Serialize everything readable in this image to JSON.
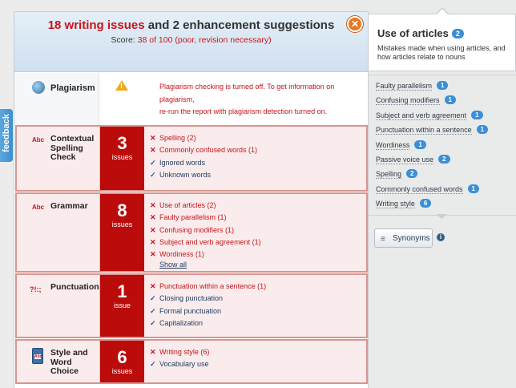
{
  "header": {
    "title_count": "18 writing issues",
    "title_rest": " and 2 enhancement suggestions",
    "score_prefix": "Score: ",
    "score_value": "38 of 100 (poor, revision necessary)",
    "close_glyph": "✕"
  },
  "plagiarism": {
    "name": "Plagiarism",
    "message_line1": "Plagiarism checking is turned off. To get information on",
    "message_line2": "plagiarism,",
    "message_line3": "re-run the report with plagiarism detection turned on."
  },
  "categories": [
    {
      "icon_text": "Abc",
      "name": "Contextual Spelling Check",
      "count": "3",
      "count_label": "issues",
      "items": [
        {
          "label": "Spelling (2)",
          "status": "bad"
        },
        {
          "label": "Commonly confused words (1)",
          "status": "bad"
        },
        {
          "label": "Ignored words",
          "status": "good"
        },
        {
          "label": "Unknown words",
          "status": "good"
        }
      ]
    },
    {
      "icon_text": "Abc",
      "name": "Grammar",
      "count": "8",
      "count_label": "issues",
      "items": [
        {
          "label": "Use of articles (2)",
          "status": "bad"
        },
        {
          "label": "Faulty parallelism (1)",
          "status": "bad"
        },
        {
          "label": "Confusing modifiers (1)",
          "status": "bad"
        },
        {
          "label": "Subject and verb agreement (1)",
          "status": "bad"
        },
        {
          "label": "Wordiness (1)",
          "status": "bad"
        }
      ],
      "show_all": "Show all"
    },
    {
      "icon_text": "?!:;",
      "name": "Punctuation",
      "count": "1",
      "count_label": "issue",
      "items": [
        {
          "label": "Punctuation within a sentence (1)",
          "status": "bad"
        },
        {
          "label": "Closing punctuation",
          "status": "good"
        },
        {
          "label": "Formal punctuation",
          "status": "good"
        },
        {
          "label": "Capitalization",
          "status": "good"
        }
      ]
    },
    {
      "icon_text": "Abc",
      "name": "Style and Word Choice",
      "count": "6",
      "count_label": "issues",
      "items": [
        {
          "label": "Writing style (6)",
          "status": "bad"
        },
        {
          "label": "Vocabulary use",
          "status": "good"
        }
      ]
    }
  ],
  "tooltip": {
    "title": "Use of articles",
    "badge": "2",
    "description": "Mistakes made when using articles, and how articles relate to nouns"
  },
  "side_list": [
    {
      "label": "Faulty parallelism",
      "count": "1"
    },
    {
      "label": "Confusing modifiers",
      "count": "1"
    },
    {
      "label": "Subject and verb agreement",
      "count": "1"
    },
    {
      "label": "Punctuation within a sentence",
      "count": "1"
    },
    {
      "label": "Wordiness",
      "count": "1"
    },
    {
      "label": "Passive voice use",
      "count": "2"
    },
    {
      "label": "Spelling",
      "count": "2"
    },
    {
      "label": "Commonly confused words",
      "count": "1"
    },
    {
      "label": "Writing style",
      "count": "6"
    }
  ],
  "synonyms_button": "Synonyms",
  "feedback_tab": "feedback",
  "colors": {
    "issue_red": "#c8141a",
    "count_bg": "#bb0b0b",
    "badge_blue": "#3b8fd6",
    "close_orange": "#e8761f"
  }
}
